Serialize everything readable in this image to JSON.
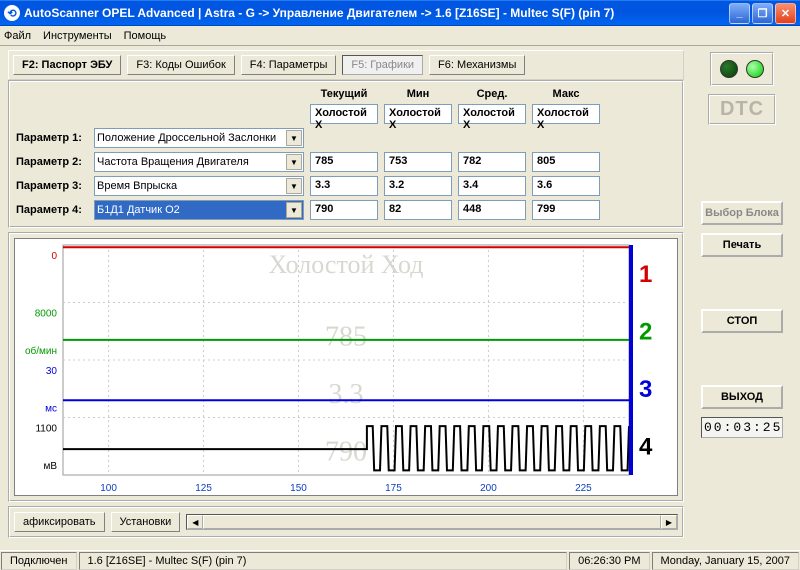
{
  "window": {
    "title": "AutoScanner OPEL Advanced | Astra - G -> Управление Двигателем -> 1.6 [Z16SE] - Multec S(F) (pin 7)"
  },
  "menu": {
    "file": "Файл",
    "tools": "Инструменты",
    "help": "Помощь"
  },
  "fkeys": {
    "f2": "F2: Паспорт ЭБУ",
    "f3": "F3: Коды Ошибок",
    "f4": "F4: Параметры",
    "f5": "F5: Графики",
    "f6": "F6: Механизмы"
  },
  "headers": {
    "current": "Текущий",
    "min": "Мин",
    "avg": "Сред.",
    "max": "Макс",
    "idle": "Холостой Х"
  },
  "params": {
    "label1": "Параметр 1:",
    "label2": "Параметр 2:",
    "label3": "Параметр 3:",
    "label4": "Параметр 4:",
    "name1": "Положение Дроссельной Заслонки",
    "name2": "Частота Вращения Двигателя",
    "name3": "Время Впрыска",
    "name4": "Б1Д1 Датчик O2",
    "r2": {
      "cur": "785",
      "min": "753",
      "avg": "782",
      "max": "805"
    },
    "r3": {
      "cur": "3.3",
      "min": "3.2",
      "avg": "3.4",
      "max": "3.6"
    },
    "r4": {
      "cur": "790",
      "min": "82",
      "avg": "448",
      "max": "799"
    }
  },
  "dtc": "DTC",
  "side": {
    "block": "Выбор Блока",
    "print": "Печать",
    "stop": "СТОП",
    "exit": "ВЫХОД",
    "timer": "00:03:25"
  },
  "bottom": {
    "fix": "афиксировать",
    "settings": "Установки"
  },
  "status": {
    "connected": "Подключен",
    "module": "1.6 [Z16SE] - Multec S(F) (pin 7)",
    "time": "06:26:30 PM",
    "date": "Monday, January 15, 2007"
  },
  "chart_data": {
    "type": "line",
    "title_watermark": "Холостой Ход",
    "x_ticks": [
      100,
      125,
      150,
      175,
      200,
      225
    ],
    "series": [
      {
        "name": "Положение Дроссельной Заслонки",
        "index": 1,
        "color": "#d40000",
        "unit": "",
        "y_label": "0",
        "value_label": "",
        "constant": 0
      },
      {
        "name": "Частота Вращения Двигателя",
        "index": 2,
        "color": "#009900",
        "unit": "об/мин",
        "y_label": "8000",
        "value_label": "785",
        "constant": 785
      },
      {
        "name": "Время Впрыска",
        "index": 3,
        "color": "#0000dd",
        "unit": "мс",
        "y_label": "30",
        "value_label": "3.3",
        "constant": 3.3
      },
      {
        "name": "Б1Д1 Датчик O2",
        "index": 4,
        "color": "#000000",
        "unit": "мВ",
        "y_label": "1100",
        "value_label": "790",
        "oscillating": true,
        "osc_start": 168,
        "osc_low": 80,
        "osc_high": 800,
        "pre_value": 430
      }
    ]
  }
}
